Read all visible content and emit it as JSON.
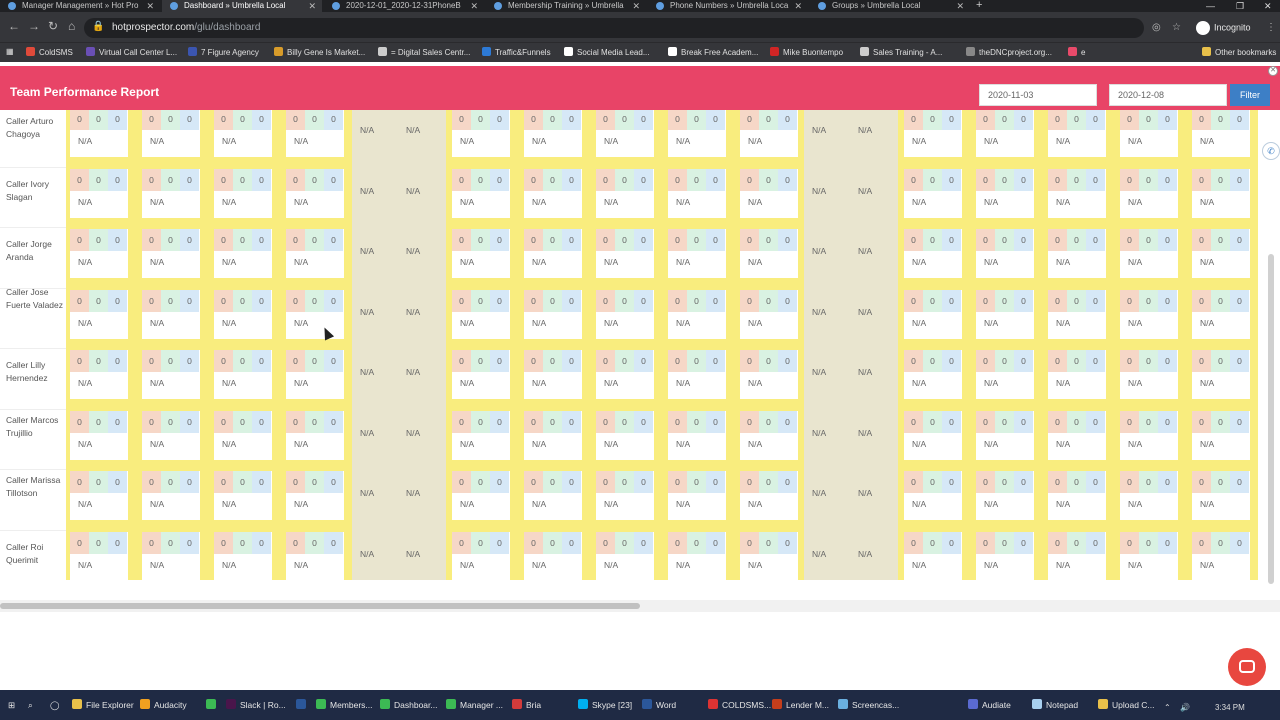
{
  "browser": {
    "tabs": [
      {
        "label": "Manager Management » Hot Pro",
        "active": false
      },
      {
        "label": "Dashboard » Umbrella Local",
        "active": true
      },
      {
        "label": "2020-12-01_2020-12-31PhoneB",
        "active": false
      },
      {
        "label": "Membership Training » Umbrella",
        "active": false
      },
      {
        "label": "Phone Numbers » Umbrella Loca",
        "active": false
      },
      {
        "label": "Groups » Umbrella Local",
        "active": false
      }
    ],
    "url_host": "hotprospector.com",
    "url_path": "/glu/dashboard",
    "incognito_label": "Incognito",
    "bookmarks": [
      {
        "label": "ColdSMS",
        "color": "#e04a3a"
      },
      {
        "label": "Virtual Call Center L...",
        "color": "#6a4fb5"
      },
      {
        "label": "7 Figure Agency",
        "color": "#3b55b0"
      },
      {
        "label": "Billy Gene Is Market...",
        "color": "#d89c2a"
      },
      {
        "label": "= Digital Sales Centr...",
        "color": "#cccccc"
      },
      {
        "label": "Traffic&Funnels",
        "color": "#2d7ad6"
      },
      {
        "label": "Social Media Lead...",
        "color": "#ffffff"
      },
      {
        "label": "Break Free Academ...",
        "color": "#ffffff"
      },
      {
        "label": "Mike Buontempo",
        "color": "#d02525"
      },
      {
        "label": "Sales Training - A...",
        "color": "#cccccc"
      },
      {
        "label": "theDNCproject.org...",
        "color": "#888888"
      },
      {
        "label": "e",
        "color": "#e84a6a"
      }
    ],
    "other_bookmarks": "Other bookmarks"
  },
  "header": {
    "title": "Team Performance Report",
    "date_from": "2020-11-03",
    "date_to": "2020-12-08",
    "filter_label": "Filter"
  },
  "callers": [
    {
      "name": "Caller Arturo Chagoya"
    },
    {
      "name": "Caller Ivory Slagan"
    },
    {
      "name": "Caller Jorge Aranda"
    },
    {
      "name": "Caller Jose Fuerte Valadez"
    },
    {
      "name": "Caller Lilly Hernendez"
    },
    {
      "name": "Caller Marcos Trujillio"
    },
    {
      "name": "Caller Marissa Tillotson"
    },
    {
      "name": "Caller Roi Querimit"
    }
  ],
  "cell_values": {
    "a": "0",
    "b": "0",
    "c": "0",
    "na": "N/A"
  },
  "taskbar": {
    "items": [
      "File Explorer",
      "Audacity",
      "Slack | Ro...",
      "Members...",
      "Dashboar...",
      "Manager ...",
      "Bria",
      "Skype [23]",
      "Word",
      "COLDSMS...",
      "Lender M...",
      "Screencas...",
      "Audiate",
      "Notepad",
      "Upload C..."
    ],
    "time": "3:34 PM"
  }
}
